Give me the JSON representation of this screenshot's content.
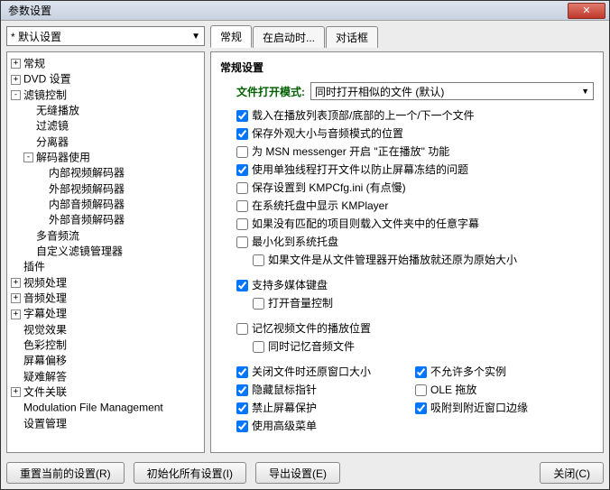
{
  "window": {
    "title": "参数设置"
  },
  "preset": {
    "value": "* 默认设置"
  },
  "tabs": [
    {
      "label": "常规",
      "active": true
    },
    {
      "label": "在启动时...",
      "active": false
    },
    {
      "label": "对话框",
      "active": false
    }
  ],
  "tree": [
    {
      "label": "常规",
      "toggle": "+"
    },
    {
      "label": "DVD 设置",
      "toggle": "+"
    },
    {
      "label": "滤镜控制",
      "toggle": "-",
      "children": [
        {
          "label": "无缝播放"
        },
        {
          "label": "过滤镜"
        },
        {
          "label": "分离器"
        },
        {
          "label": "解码器使用",
          "toggle": "-",
          "children": [
            {
              "label": "内部视频解码器"
            },
            {
              "label": "外部视频解码器"
            },
            {
              "label": "内部音频解码器"
            },
            {
              "label": "外部音频解码器"
            }
          ]
        },
        {
          "label": "多音频流"
        },
        {
          "label": "自定义滤镜管理器"
        }
      ]
    },
    {
      "label": "插件"
    },
    {
      "label": "视频处理",
      "toggle": "+"
    },
    {
      "label": "音频处理",
      "toggle": "+"
    },
    {
      "label": "字幕处理",
      "toggle": "+"
    },
    {
      "label": "视觉效果"
    },
    {
      "label": "色彩控制"
    },
    {
      "label": "屏幕偏移"
    },
    {
      "label": "疑难解答"
    },
    {
      "label": "文件关联",
      "toggle": "+"
    },
    {
      "label": "Modulation File Management"
    },
    {
      "label": "设置管理"
    }
  ],
  "panel": {
    "heading": "常规设置",
    "open_mode_label": "文件打开模式:",
    "open_mode_value": "同时打开相似的文件 (默认)",
    "checks": [
      {
        "id": "c1",
        "label": "载入在播放列表顶部/底部的上一个/下一个文件",
        "checked": true
      },
      {
        "id": "c2",
        "label": "保存外观大小与音频模式的位置",
        "checked": true
      },
      {
        "id": "c3",
        "label": "为 MSN messenger 开启 \"正在播放\" 功能",
        "checked": false
      },
      {
        "id": "c4",
        "label": "使用单独线程打开文件以防止屏幕冻结的问题",
        "checked": true
      },
      {
        "id": "c5",
        "label": "保存设置到 KMPCfg.ini (有点慢)",
        "checked": false
      },
      {
        "id": "c6",
        "label": "在系统托盘中显示 KMPlayer",
        "checked": false
      },
      {
        "id": "c7",
        "label": "如果没有匹配的项目则载入文件夹中的任意字幕",
        "checked": false
      },
      {
        "id": "c8",
        "label": "最小化到系统托盘",
        "checked": false
      },
      {
        "id": "c9",
        "label": "如果文件是从文件管理器开始播放就还原为原始大小",
        "checked": false,
        "indent": true
      }
    ],
    "group2": [
      {
        "id": "g2a",
        "label": "支持多媒体键盘",
        "checked": true
      },
      {
        "id": "g2b",
        "label": "打开音量控制",
        "checked": false,
        "indent": true
      }
    ],
    "group3": [
      {
        "id": "g3a",
        "label": "记忆视频文件的播放位置",
        "checked": false
      },
      {
        "id": "g3b",
        "label": "同时记忆音频文件",
        "checked": false,
        "indent": true
      }
    ],
    "grid": {
      "left": [
        {
          "id": "gl1",
          "label": "关闭文件时还原窗口大小",
          "checked": true
        },
        {
          "id": "gl2",
          "label": "隐藏鼠标指针",
          "checked": true
        },
        {
          "id": "gl3",
          "label": "禁止屏幕保护",
          "checked": true
        },
        {
          "id": "gl4",
          "label": "使用高级菜单",
          "checked": true
        }
      ],
      "right": [
        {
          "id": "gr1",
          "label": "不允许多个实例",
          "checked": true
        },
        {
          "id": "gr2",
          "label": "OLE 拖放",
          "checked": false
        },
        {
          "id": "gr3",
          "label": "吸附到附近窗口边缘",
          "checked": true
        }
      ]
    }
  },
  "buttons": {
    "reset": "重置当前的设置(R)",
    "init_all": "初始化所有设置(I)",
    "export": "导出设置(E)",
    "close": "关闭(C)"
  }
}
